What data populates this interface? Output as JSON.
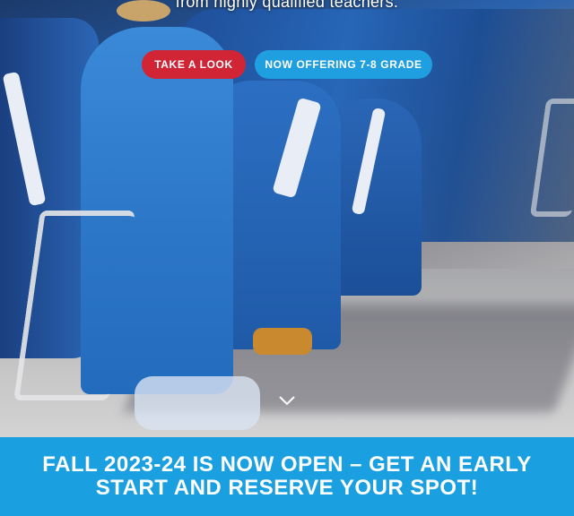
{
  "hero": {
    "tagline": "from highly qualified teachers.",
    "buttons": {
      "take_look": "TAKE A LOOK",
      "offering": "NOW OFFERING 7-8 GRADE"
    },
    "scroll_icon": "chevron-down-icon"
  },
  "banner": {
    "text": "FALL 2023-24 IS NOW OPEN – GET AN EARLY START AND RESERVE YOUR SPOT!"
  },
  "colors": {
    "primary_red": "#d12536",
    "primary_blue": "#1f9ee0",
    "banner_blue": "#1a9fe0"
  }
}
